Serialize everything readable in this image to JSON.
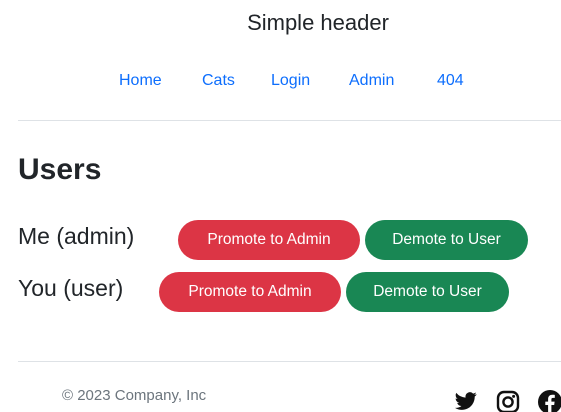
{
  "header": {
    "title": "Simple header",
    "nav": [
      "Home",
      "Cats",
      "Login",
      "Admin",
      "404"
    ]
  },
  "main": {
    "heading": "Users",
    "users": [
      {
        "name": "Me (admin)",
        "promote_label": "Promote to Admin",
        "demote_label": "Demote to User"
      },
      {
        "name": "You (user)",
        "promote_label": "Promote to Admin",
        "demote_label": "Demote to User"
      }
    ]
  },
  "footer": {
    "copyright": "© 2023 Company, Inc",
    "social_icons": [
      "twitter-icon",
      "instagram-icon",
      "facebook-icon"
    ]
  },
  "colors": {
    "link": "#0d6efd",
    "promote": "#dc3545",
    "demote": "#198754",
    "muted": "#6c757d"
  }
}
